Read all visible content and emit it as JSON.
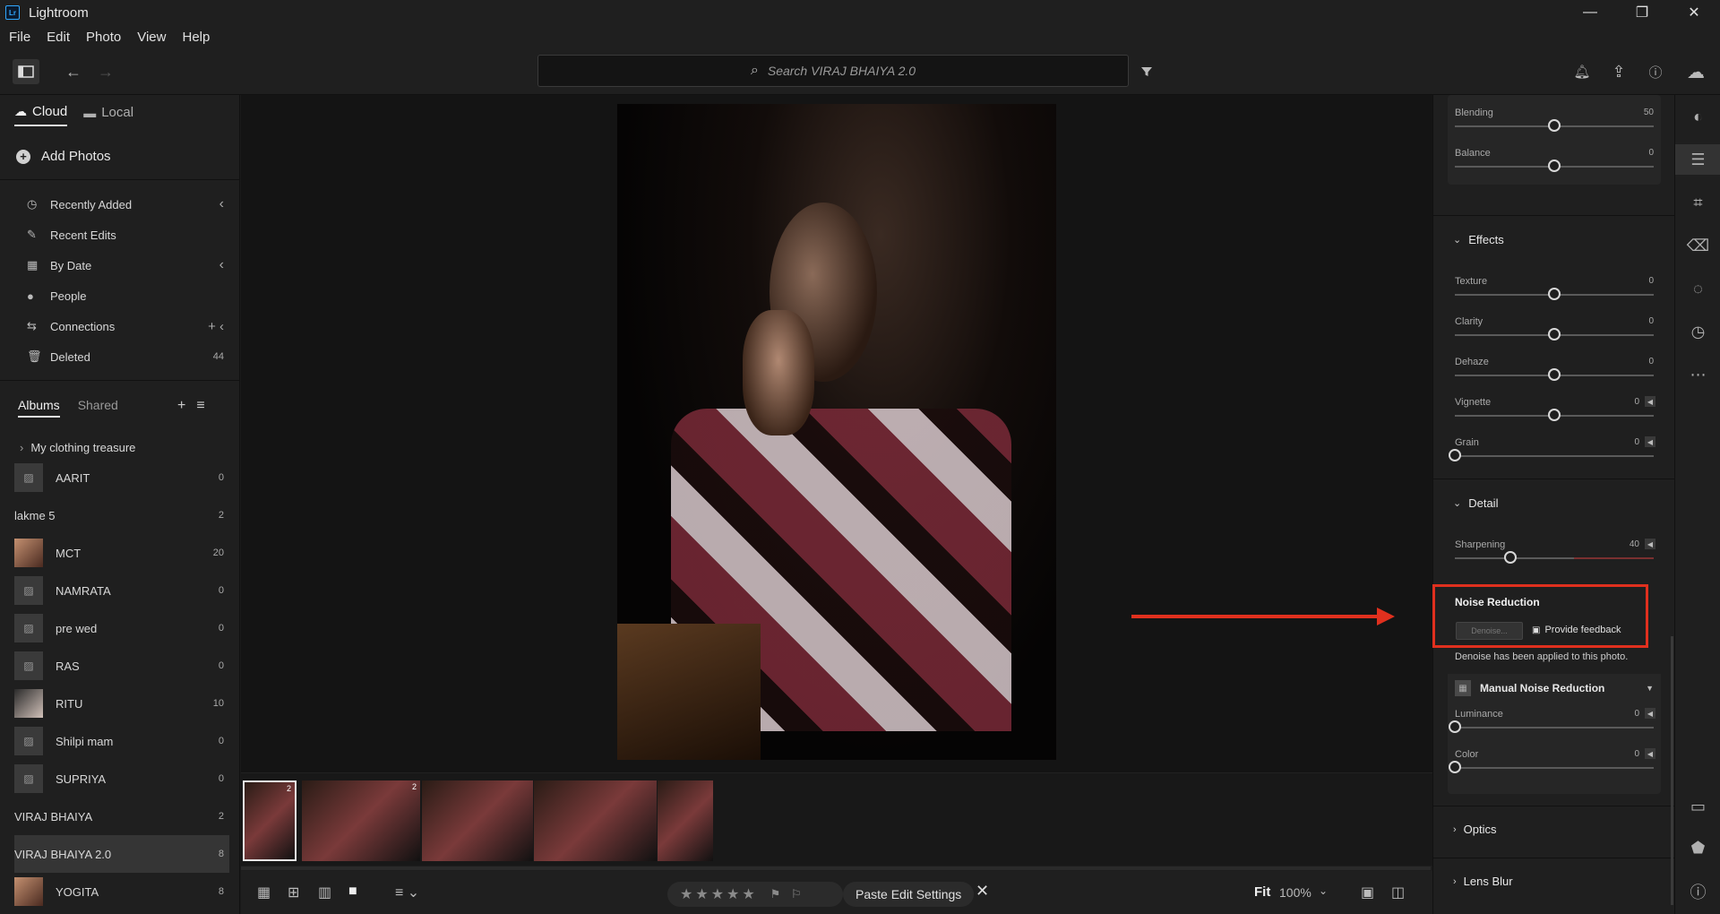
{
  "app": {
    "title": "Lightroom",
    "logo_text": "Lr",
    "window_controls": [
      "—",
      "❐",
      "✕"
    ]
  },
  "menu": [
    "File",
    "Edit",
    "Photo",
    "View",
    "Help"
  ],
  "toolbar": {
    "search_placeholder": "Search VIRAJ BHAIYA 2.0",
    "icons": [
      "panel-toggle-icon",
      "back-arrow-icon",
      "forward-arrow-icon",
      "filter-icon",
      "bell-icon",
      "share-icon",
      "help-icon",
      "cloud-icon"
    ]
  },
  "left": {
    "tabs": [
      {
        "label": "Cloud",
        "icon": "☁",
        "active": true
      },
      {
        "label": "Local",
        "icon": "▬",
        "active": false
      }
    ],
    "add_photos": "Add Photos",
    "nav": [
      {
        "label": "Recently Added",
        "icon": "◷",
        "right": "‹"
      },
      {
        "label": "Recent Edits",
        "icon": "✎",
        "right": ""
      },
      {
        "label": "By Date",
        "icon": "▦",
        "right": "‹"
      },
      {
        "label": "People",
        "icon": "●",
        "right": ""
      },
      {
        "label": "Connections",
        "icon": "⇆",
        "right": "+  ‹"
      },
      {
        "label": "Deleted",
        "icon": "🗑",
        "right": "44"
      }
    ],
    "album_tabs": [
      "Albums",
      "Shared"
    ],
    "folder": "My clothing treasure",
    "albums": [
      {
        "name": "AARIT",
        "count": "0",
        "thumb": "placeholder"
      },
      {
        "name": "lakme 5",
        "count": "2",
        "thumb": "photo"
      },
      {
        "name": "MCT",
        "count": "20",
        "thumb": "photo2"
      },
      {
        "name": "NAMRATA",
        "count": "0",
        "thumb": "placeholder"
      },
      {
        "name": "pre wed",
        "count": "0",
        "thumb": "placeholder"
      },
      {
        "name": "RAS",
        "count": "0",
        "thumb": "placeholder"
      },
      {
        "name": "RITU",
        "count": "10",
        "thumb": "photo3"
      },
      {
        "name": "Shilpi mam",
        "count": "0",
        "thumb": "placeholder"
      },
      {
        "name": "SUPRIYA",
        "count": "0",
        "thumb": "placeholder"
      },
      {
        "name": "VIRAJ BHAIYA",
        "count": "2",
        "thumb": "photo"
      },
      {
        "name": "VIRAJ BHAIYA 2.0",
        "count": "8",
        "thumb": "photo",
        "selected": true
      },
      {
        "name": "YOGITA",
        "count": "8",
        "thumb": "photo2"
      }
    ]
  },
  "filmstrip": {
    "thumbs": [
      {
        "badge": "2",
        "selected": true
      },
      {
        "badge": "2",
        "selected": false
      },
      {
        "badge": "",
        "selected": false
      },
      {
        "badge": "",
        "selected": false
      },
      {
        "badge": "",
        "selected": false
      }
    ]
  },
  "bottombar": {
    "stars": "★★★★★",
    "flags": "⚑ ⚐",
    "paste_label": "Paste Edit Settings",
    "close": "✕",
    "fit": "Fit",
    "zoom": "100%",
    "zoom_chevron": "⌄"
  },
  "edit": {
    "top_sliders": [
      {
        "label": "Blending",
        "value": "50",
        "pos": 0.5
      },
      {
        "label": "Balance",
        "value": "0",
        "pos": 0.5
      }
    ],
    "effects": {
      "title": "Effects",
      "sliders": [
        {
          "label": "Texture",
          "value": "0",
          "pos": 0.5
        },
        {
          "label": "Clarity",
          "value": "0",
          "pos": 0.5
        },
        {
          "label": "Dehaze",
          "value": "0",
          "pos": 0.5
        },
        {
          "label": "Vignette",
          "value": "0",
          "pos": 0.5,
          "arrow": true
        },
        {
          "label": "Grain",
          "value": "0",
          "pos": 0,
          "arrow": true
        }
      ]
    },
    "detail": {
      "title": "Detail",
      "sliders": [
        {
          "label": "Sharpening",
          "value": "40",
          "pos": 0.28,
          "arrow": true,
          "red": true
        }
      ]
    },
    "noise_reduction": {
      "title": "Noise Reduction",
      "denoise_label": "Denoise...",
      "feedback_label": "Provide feedback",
      "note": "Denoise has been applied to this photo.",
      "manual_label": "Manual Noise Reduction",
      "sliders": [
        {
          "label": "Luminance",
          "value": "0",
          "pos": 0,
          "arrow": true
        },
        {
          "label": "Color",
          "value": "0",
          "pos": 0,
          "arrow": true
        }
      ]
    },
    "optics": "Optics",
    "lens_blur": "Lens Blur"
  },
  "colors": {
    "accent_red": "#e0301e",
    "panel": "#1f1f1f",
    "canvas": "#141414"
  }
}
